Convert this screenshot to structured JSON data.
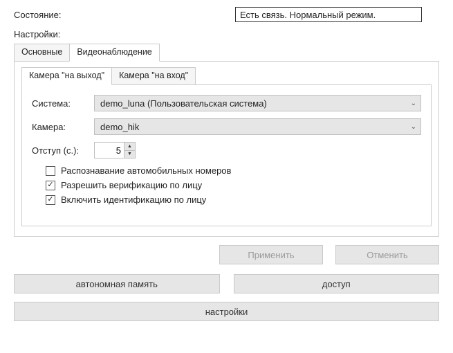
{
  "status": {
    "label": "Состояние:",
    "value": "Есть связь. Нормальный режим."
  },
  "settings_label": "Настройки:",
  "tabs": {
    "main": "Основные",
    "video": "Видеонаблюдение"
  },
  "subtabs": {
    "camera_out": "Камера \"на выход\"",
    "camera_in": "Камера \"на вход\""
  },
  "fields": {
    "system_label": "Система:",
    "system_value": "demo_luna (Пользовательская система)",
    "camera_label": "Камера:",
    "camera_value": "demo_hik",
    "offset_label": "Отступ (с.):",
    "offset_value": "5"
  },
  "checks": {
    "plate": {
      "label": "Распознавание автомобильных номеров",
      "checked": false
    },
    "verify": {
      "label": "Разрешить верификацию по лицу",
      "checked": true
    },
    "identify": {
      "label": "Включить идентификацию по лицу",
      "checked": true
    }
  },
  "buttons": {
    "apply": "Применить",
    "cancel": "Отменить",
    "autonomous": "автономная память",
    "access": "доступ",
    "settings": "настройки"
  },
  "glyphs": {
    "chevron_down": "⌄",
    "up": "▲",
    "down": "▼",
    "check": "✓"
  }
}
